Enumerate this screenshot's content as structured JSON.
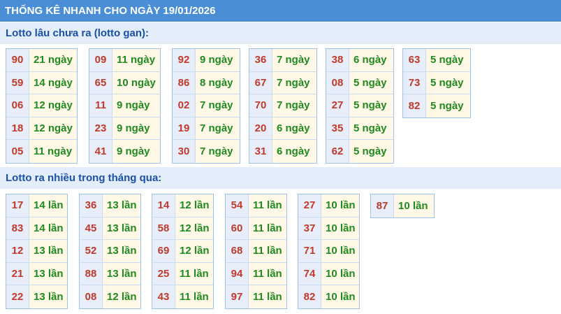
{
  "header": {
    "title": "THỐNG KÊ NHANH CHO NGÀY 19/01/2026"
  },
  "section1": {
    "title": "Lotto lâu chưa ra (lotto gan):",
    "columns": [
      [
        {
          "num": "90",
          "val": "21 ngày"
        },
        {
          "num": "59",
          "val": "14 ngày"
        },
        {
          "num": "06",
          "val": "12 ngày"
        },
        {
          "num": "18",
          "val": "12 ngày"
        },
        {
          "num": "05",
          "val": "11 ngày"
        }
      ],
      [
        {
          "num": "09",
          "val": "11 ngày"
        },
        {
          "num": "65",
          "val": "10 ngày"
        },
        {
          "num": "11",
          "val": "9 ngày"
        },
        {
          "num": "23",
          "val": "9 ngày"
        },
        {
          "num": "41",
          "val": "9 ngày"
        }
      ],
      [
        {
          "num": "92",
          "val": "9 ngày"
        },
        {
          "num": "86",
          "val": "8 ngày"
        },
        {
          "num": "02",
          "val": "7 ngày"
        },
        {
          "num": "19",
          "val": "7 ngày"
        },
        {
          "num": "30",
          "val": "7 ngày"
        }
      ],
      [
        {
          "num": "36",
          "val": "7 ngày"
        },
        {
          "num": "67",
          "val": "7 ngày"
        },
        {
          "num": "70",
          "val": "7 ngày"
        },
        {
          "num": "20",
          "val": "6 ngày"
        },
        {
          "num": "31",
          "val": "6 ngày"
        }
      ],
      [
        {
          "num": "38",
          "val": "6 ngày"
        },
        {
          "num": "08",
          "val": "5 ngày"
        },
        {
          "num": "27",
          "val": "5 ngày"
        },
        {
          "num": "35",
          "val": "5 ngày"
        },
        {
          "num": "62",
          "val": "5 ngày"
        }
      ],
      [
        {
          "num": "63",
          "val": "5 ngày"
        },
        {
          "num": "73",
          "val": "5 ngày"
        },
        {
          "num": "82",
          "val": "5 ngày"
        }
      ]
    ]
  },
  "section2": {
    "title": "Lotto ra nhiều trong tháng qua:",
    "columns": [
      [
        {
          "num": "17",
          "val": "14 lần"
        },
        {
          "num": "83",
          "val": "14 lần"
        },
        {
          "num": "12",
          "val": "13 lần"
        },
        {
          "num": "21",
          "val": "13 lần"
        },
        {
          "num": "22",
          "val": "13 lần"
        }
      ],
      [
        {
          "num": "36",
          "val": "13 lần"
        },
        {
          "num": "45",
          "val": "13 lần"
        },
        {
          "num": "52",
          "val": "13 lần"
        },
        {
          "num": "88",
          "val": "13 lần"
        },
        {
          "num": "08",
          "val": "12 lần"
        }
      ],
      [
        {
          "num": "14",
          "val": "12 lần"
        },
        {
          "num": "58",
          "val": "12 lần"
        },
        {
          "num": "69",
          "val": "12 lần"
        },
        {
          "num": "25",
          "val": "11 lần"
        },
        {
          "num": "43",
          "val": "11 lần"
        }
      ],
      [
        {
          "num": "54",
          "val": "11 lần"
        },
        {
          "num": "60",
          "val": "11 lần"
        },
        {
          "num": "68",
          "val": "11 lần"
        },
        {
          "num": "94",
          "val": "11 lần"
        },
        {
          "num": "97",
          "val": "11 lần"
        }
      ],
      [
        {
          "num": "27",
          "val": "10 lần"
        },
        {
          "num": "37",
          "val": "10 lần"
        },
        {
          "num": "71",
          "val": "10 lần"
        },
        {
          "num": "74",
          "val": "10 lần"
        },
        {
          "num": "82",
          "val": "10 lần"
        }
      ],
      [
        {
          "num": "87",
          "val": "10 lần"
        }
      ]
    ]
  }
}
